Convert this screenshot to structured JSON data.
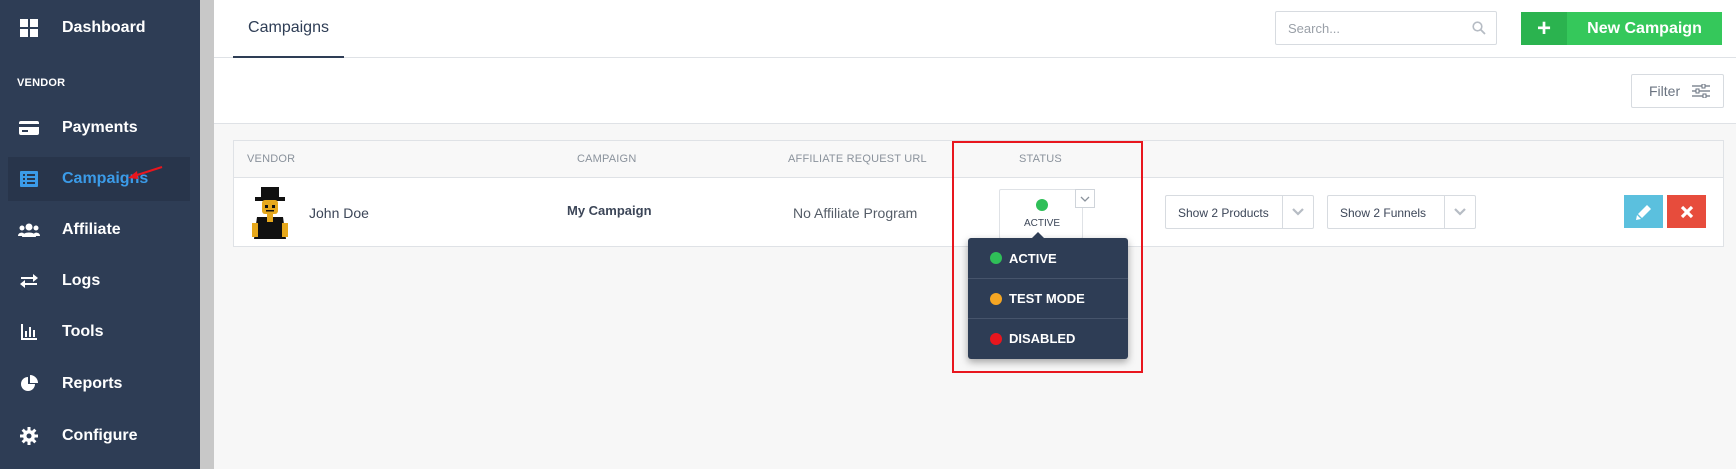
{
  "sidebar": {
    "items": [
      {
        "label": "Dashboard",
        "icon": "grid-icon"
      },
      {
        "label": "Payments",
        "icon": "credit-card-icon"
      },
      {
        "label": "Campaigns",
        "icon": "list-icon"
      },
      {
        "label": "Affiliate",
        "icon": "users-icon"
      },
      {
        "label": "Logs",
        "icon": "swap-arrows-icon"
      },
      {
        "label": "Tools",
        "icon": "bar-chart-icon"
      },
      {
        "label": "Reports",
        "icon": "pie-chart-icon"
      },
      {
        "label": "Configure",
        "icon": "gear-icon"
      }
    ],
    "section_label": "VENDOR",
    "active_item": "Campaigns"
  },
  "header": {
    "tab_label": "Campaigns",
    "search_placeholder": "Search...",
    "new_campaign_label": "New Campaign",
    "new_campaign_icon": "+"
  },
  "subheader": {
    "filter_label": "Filter"
  },
  "table": {
    "columns": [
      "VENDOR",
      "CAMPAIGN",
      "AFFILIATE REQUEST URL",
      "STATUS"
    ],
    "rows": [
      {
        "vendor": "John Doe",
        "campaign": "My Campaign",
        "affiliate_url": "No Affiliate Program",
        "status": "ACTIVE",
        "products_select": "Show 2 Products",
        "funnels_select": "Show 2 Funnels"
      }
    ]
  },
  "status_dropdown": {
    "options": [
      {
        "label": "ACTIVE",
        "color": "#2fbf58"
      },
      {
        "label": "TEST MODE",
        "color": "#f5a623"
      },
      {
        "label": "DISABLED",
        "color": "#e8161e"
      }
    ]
  },
  "colors": {
    "sidebar_bg": "#2e3d55",
    "accent_blue": "#3b9be8",
    "primary_green": "#35c85b",
    "edit_blue": "#5bc0de",
    "delete_red": "#e74c3c",
    "highlight_red": "#e8161e"
  }
}
